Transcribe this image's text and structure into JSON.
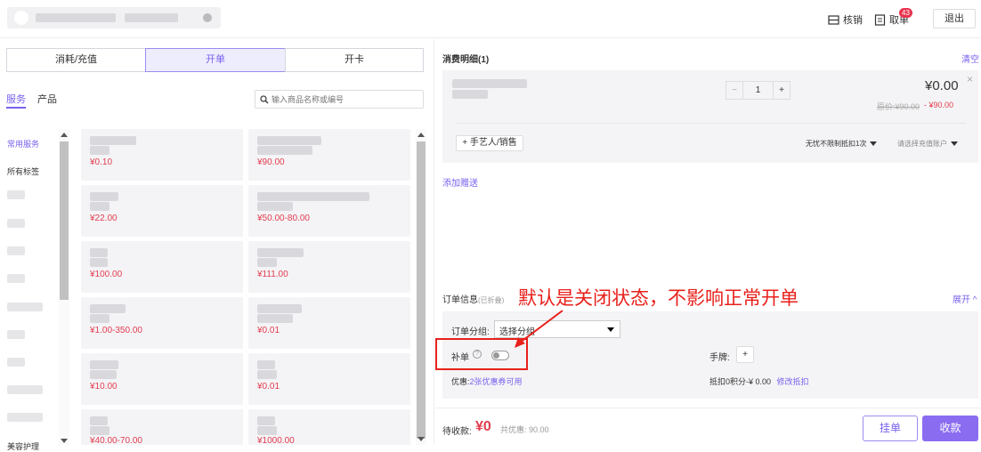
{
  "header": {
    "verify_label": "核销",
    "take_order_label": "取单",
    "take_order_badge": "43",
    "logout_label": "退出"
  },
  "tabs": [
    {
      "label": "消耗/充值"
    },
    {
      "label": "开单"
    },
    {
      "label": "开卡"
    }
  ],
  "filter_tabs": [
    {
      "label": "服务"
    },
    {
      "label": "产品"
    }
  ],
  "search": {
    "placeholder": "输入商品名称或编号"
  },
  "categories": [
    {
      "label": "常用服务"
    },
    {
      "label": "所有标签"
    },
    {
      "label": "美容护理"
    }
  ],
  "products": [
    {
      "price": "¥0.10"
    },
    {
      "price": "¥90.00"
    },
    {
      "price": "¥22.00"
    },
    {
      "price": "¥50.00-80.00"
    },
    {
      "price": "¥100.00"
    },
    {
      "price": "¥111.00"
    },
    {
      "price": "¥1.00-350.00"
    },
    {
      "price": "¥0.01"
    },
    {
      "price": "¥10.00"
    },
    {
      "price": "¥0.01"
    },
    {
      "price": "¥40.00-70.00"
    },
    {
      "price": "¥1000.00"
    }
  ],
  "detail": {
    "title": "消费明细(1)",
    "clear_label": "清空",
    "quantity": "1",
    "minus": "−",
    "plus": "+",
    "item_price": "¥0.00",
    "original_price": "原价:¥90.00",
    "discount": "- ¥90.00",
    "add_staff_label": "+ 手艺人/销售",
    "deduct_option": "无忧不限制抵扣1次",
    "account_placeholder": "请选择充值账户",
    "add_gift_label": "添加赠送"
  },
  "order_info": {
    "title": "订单信息",
    "folded_note": "(已折叠)",
    "expand_label": "展开",
    "group_label": "订单分组:",
    "group_select_value": "选择分组",
    "supplement_label": "补单",
    "gesture_label": "手牌:",
    "gesture_add": "+",
    "discount_label": "优惠:",
    "coupon_text": "2张优惠券可用",
    "points_text": "抵扣0积分-¥ 0.00",
    "modify_deduct": "修改抵扣"
  },
  "footer": {
    "due_label": "待收款:",
    "due_amount": "¥0",
    "total_discount": "共优惠: 90.00",
    "hold_label": "挂单",
    "checkout_label": "收款"
  },
  "annotation": {
    "text": "默认是关闭状态，不影响正常开单"
  },
  "colors": {
    "accent": "#7a61ee",
    "price": "#e23c4f",
    "annotation": "#e8201b"
  }
}
